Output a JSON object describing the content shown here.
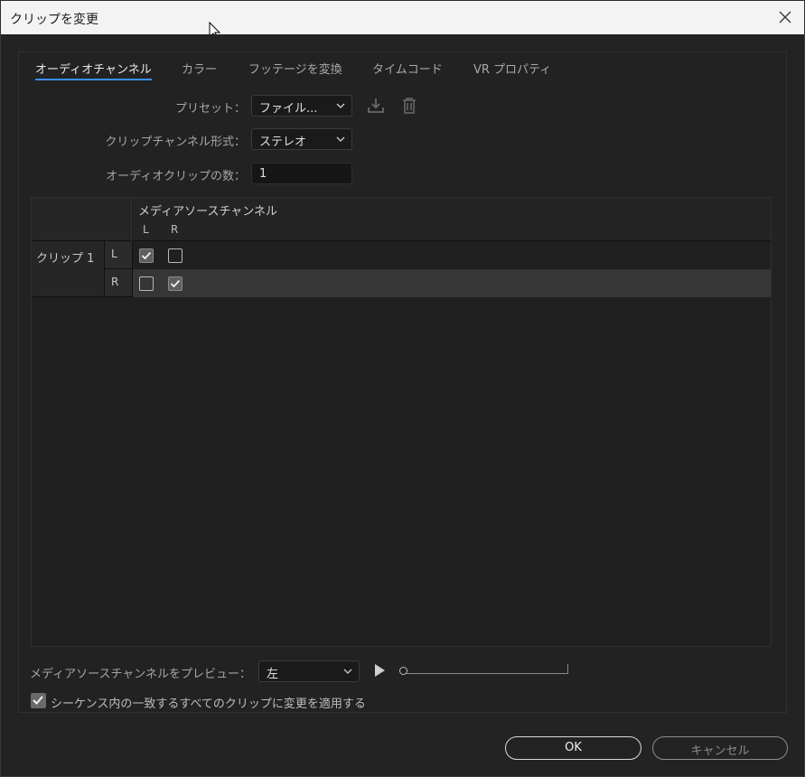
{
  "window": {
    "title": "クリップを変更"
  },
  "tabs": [
    {
      "label": "オーディオチャンネル",
      "active": true
    },
    {
      "label": "カラー",
      "active": false
    },
    {
      "label": "フッテージを変換",
      "active": false
    },
    {
      "label": "タイムコード",
      "active": false
    },
    {
      "label": "VR プロパティ",
      "active": false
    }
  ],
  "form": {
    "preset_label": "プリセット：",
    "preset_value": "ファイル...",
    "format_label": "クリップチャンネル形式：",
    "format_value": "ステレオ",
    "count_label": "オーディオクリップの数：",
    "count_value": "1"
  },
  "grid": {
    "header_title": "メディアソースチャンネル",
    "channel_headers": [
      "L",
      "R"
    ],
    "clip_label": "クリップ 1",
    "rows": [
      {
        "channel": "L",
        "checks": [
          true,
          false
        ]
      },
      {
        "channel": "R",
        "checks": [
          false,
          true
        ]
      }
    ]
  },
  "preview": {
    "label": "メディアソースチャンネルをプレビュー：",
    "value": "左",
    "position": 0
  },
  "apply": {
    "label": "シーケンス内の一致するすべてのクリップに変更を適用する",
    "checked": true
  },
  "buttons": {
    "ok": "OK",
    "cancel": "キャンセル"
  },
  "colors": {
    "accent": "#3a8ee6",
    "background": "#232323"
  }
}
